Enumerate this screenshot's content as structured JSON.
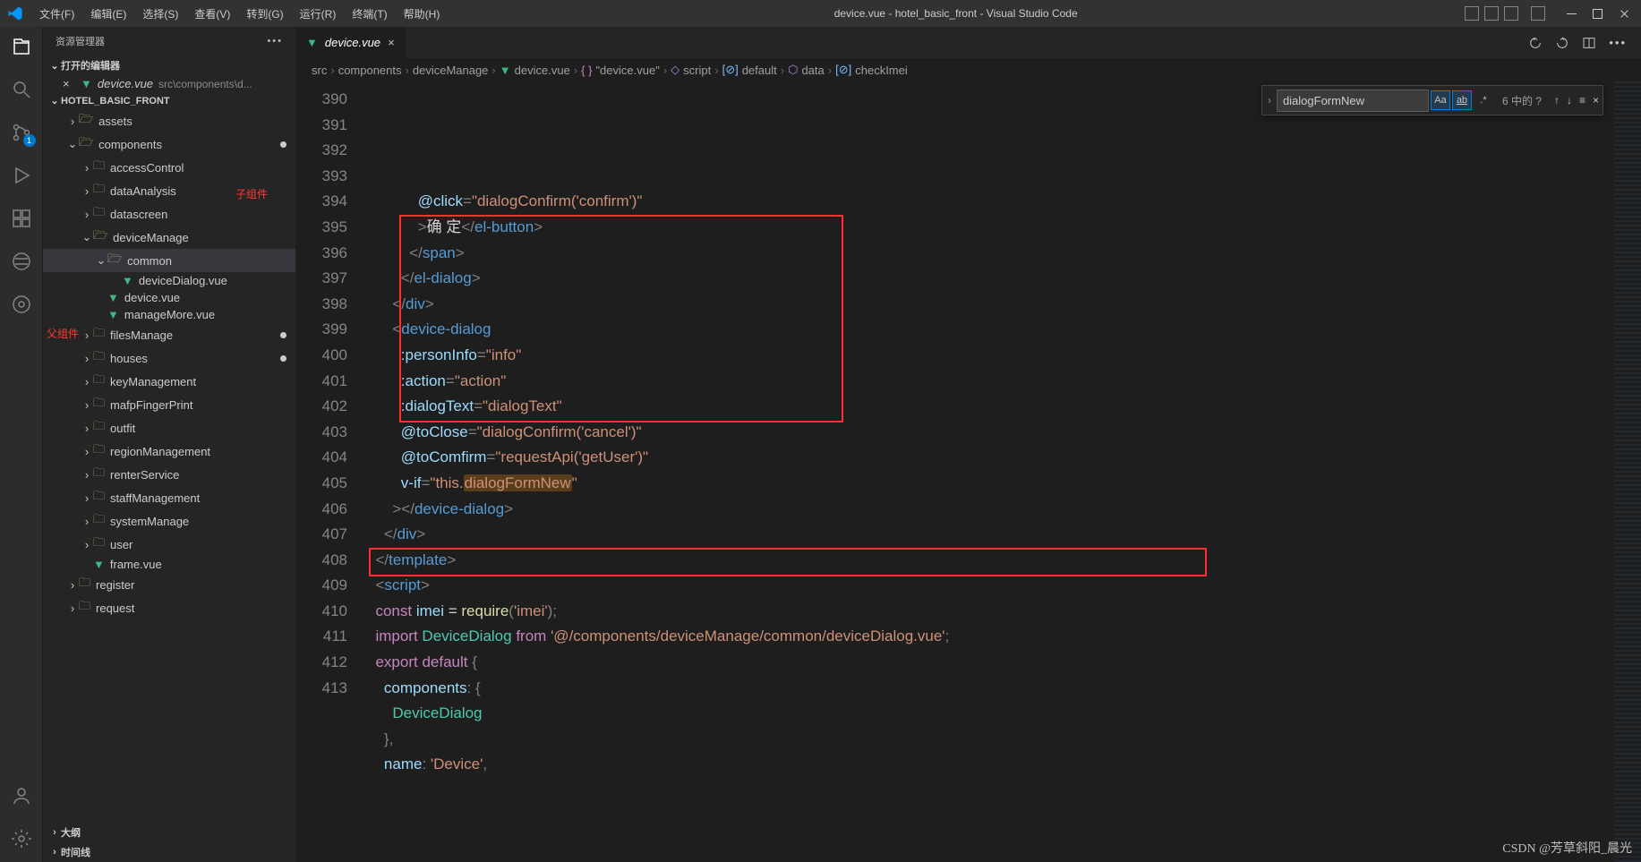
{
  "titlebar": {
    "menus": [
      "文件(F)",
      "编辑(E)",
      "选择(S)",
      "查看(V)",
      "转到(G)",
      "运行(R)",
      "终端(T)",
      "帮助(H)"
    ],
    "title": "device.vue - hotel_basic_front - Visual Studio Code"
  },
  "activity": {
    "scm_badge": "1"
  },
  "sidebar": {
    "title": "资源管理器",
    "sections": {
      "openEditors": "打开的编辑器",
      "project": "HOTEL_BASIC_FRONT",
      "outline": "大纲",
      "timeline": "时间线"
    },
    "openEditor": {
      "file": "device.vue",
      "path": "src\\components\\d..."
    },
    "tree": [
      {
        "depth": 0,
        "chev": "›",
        "type": "folder-open",
        "label": "assets"
      },
      {
        "depth": 0,
        "chev": "⌄",
        "type": "folder-open",
        "label": "components",
        "dot": true
      },
      {
        "depth": 1,
        "chev": "›",
        "type": "folder",
        "label": "accessControl"
      },
      {
        "depth": 1,
        "chev": "›",
        "type": "folder",
        "label": "dataAnalysis"
      },
      {
        "depth": 1,
        "chev": "›",
        "type": "folder",
        "label": "datascreen"
      },
      {
        "depth": 1,
        "chev": "⌄",
        "type": "folder-open",
        "label": "deviceManage"
      },
      {
        "depth": 2,
        "chev": "⌄",
        "type": "folder-open",
        "label": "common",
        "selected": true
      },
      {
        "depth": 3,
        "chev": "",
        "type": "vue",
        "label": "deviceDialog.vue"
      },
      {
        "depth": 2,
        "chev": "",
        "type": "vue",
        "label": "device.vue"
      },
      {
        "depth": 2,
        "chev": "",
        "type": "vue",
        "label": "manageMore.vue"
      },
      {
        "depth": 1,
        "chev": "›",
        "type": "folder",
        "label": "filesManage",
        "dot": true
      },
      {
        "depth": 1,
        "chev": "›",
        "type": "folder",
        "label": "houses",
        "dot": true
      },
      {
        "depth": 1,
        "chev": "›",
        "type": "folder",
        "label": "keyManagement"
      },
      {
        "depth": 1,
        "chev": "›",
        "type": "folder",
        "label": "mafpFingerPrint"
      },
      {
        "depth": 1,
        "chev": "›",
        "type": "folder",
        "label": "outfit"
      },
      {
        "depth": 1,
        "chev": "›",
        "type": "folder",
        "label": "regionManagement"
      },
      {
        "depth": 1,
        "chev": "›",
        "type": "folder",
        "label": "renterService"
      },
      {
        "depth": 1,
        "chev": "›",
        "type": "folder",
        "label": "staffManagement"
      },
      {
        "depth": 1,
        "chev": "›",
        "type": "folder",
        "label": "systemManage"
      },
      {
        "depth": 1,
        "chev": "›",
        "type": "folder",
        "label": "user"
      },
      {
        "depth": 1,
        "chev": "",
        "type": "vue",
        "label": "frame.vue"
      },
      {
        "depth": 0,
        "chev": "›",
        "type": "folder",
        "label": "register"
      },
      {
        "depth": 0,
        "chev": "›",
        "type": "folder",
        "label": "request"
      }
    ],
    "annotations": {
      "child": "子组件",
      "parent": "父组件"
    }
  },
  "tab": {
    "file": "device.vue"
  },
  "breadcrumbs": [
    "src",
    "components",
    "deviceManage",
    "device.vue",
    "\"device.vue\"",
    "script",
    "default",
    "data",
    "checkImei"
  ],
  "find": {
    "value": "dialogFormNew",
    "count": "6 中的 ?"
  },
  "code": {
    "startLine": 390,
    "lines": [
      [
        [
          "            ",
          "txt"
        ],
        [
          "@click",
          "attr"
        ],
        [
          "=",
          "punc"
        ],
        [
          "\"dialogConfirm('confirm')\"",
          "str"
        ]
      ],
      [
        [
          "            ",
          "txt"
        ],
        [
          ">",
          "punc"
        ],
        [
          "确 定",
          "txt"
        ],
        [
          "</",
          "punc"
        ],
        [
          "el-button",
          "tag"
        ],
        [
          ">",
          "punc"
        ]
      ],
      [
        [
          "          ",
          "txt"
        ],
        [
          "</",
          "punc"
        ],
        [
          "span",
          "tag"
        ],
        [
          ">",
          "punc"
        ]
      ],
      [
        [
          "        ",
          "txt"
        ],
        [
          "</",
          "punc"
        ],
        [
          "el-dialog",
          "tag"
        ],
        [
          ">",
          "punc"
        ]
      ],
      [
        [
          "      ",
          "txt"
        ],
        [
          "</",
          "punc"
        ],
        [
          "div",
          "tag"
        ],
        [
          ">",
          "punc"
        ]
      ],
      [
        [
          "      ",
          "txt"
        ],
        [
          "<",
          "punc"
        ],
        [
          "device-dialog",
          "tag"
        ]
      ],
      [
        [
          "        ",
          "txt"
        ],
        [
          ":personInfo",
          "attr"
        ],
        [
          "=",
          "punc"
        ],
        [
          "\"info\"",
          "str"
        ]
      ],
      [
        [
          "        ",
          "txt"
        ],
        [
          ":action",
          "attr"
        ],
        [
          "=",
          "punc"
        ],
        [
          "\"action\"",
          "str"
        ]
      ],
      [
        [
          "        ",
          "txt"
        ],
        [
          ":dialogText",
          "attr"
        ],
        [
          "=",
          "punc"
        ],
        [
          "\"dialogText\"",
          "str"
        ]
      ],
      [
        [
          "        ",
          "txt"
        ],
        [
          "@toClose",
          "attr"
        ],
        [
          "=",
          "punc"
        ],
        [
          "\"dialogConfirm('cancel')\"",
          "str"
        ]
      ],
      [
        [
          "        ",
          "txt"
        ],
        [
          "@toComfirm",
          "attr"
        ],
        [
          "=",
          "punc"
        ],
        [
          "\"requestApi('getUser')\"",
          "str"
        ]
      ],
      [
        [
          "        ",
          "txt"
        ],
        [
          "v-if",
          "attr"
        ],
        [
          "=",
          "punc"
        ],
        [
          "\"this.",
          "str"
        ],
        [
          "dialogFormNew",
          "hl"
        ],
        [
          "\"",
          "str"
        ]
      ],
      [
        [
          "      ",
          "txt"
        ],
        [
          "></",
          "punc"
        ],
        [
          "device-dialog",
          "tag"
        ],
        [
          ">",
          "punc"
        ]
      ],
      [
        [
          "    ",
          "txt"
        ],
        [
          "</",
          "punc"
        ],
        [
          "div",
          "tag"
        ],
        [
          ">",
          "punc"
        ]
      ],
      [
        [
          "  ",
          "txt"
        ],
        [
          "</",
          "punc"
        ],
        [
          "template",
          "tag"
        ],
        [
          ">",
          "punc"
        ]
      ],
      [
        [
          "",
          "txt"
        ]
      ],
      [
        [
          "  ",
          "txt"
        ],
        [
          "<",
          "punc"
        ],
        [
          "script",
          "tag"
        ],
        [
          ">",
          "punc"
        ]
      ],
      [
        [
          "  ",
          "txt"
        ],
        [
          "const",
          "kw"
        ],
        [
          " ",
          "txt"
        ],
        [
          "imei",
          "var"
        ],
        [
          " = ",
          "txt"
        ],
        [
          "require",
          "fn"
        ],
        [
          "(",
          "punc"
        ],
        [
          "'imei'",
          "str"
        ],
        [
          ");",
          "punc"
        ]
      ],
      [
        [
          "  ",
          "txt"
        ],
        [
          "import",
          "kw"
        ],
        [
          " ",
          "txt"
        ],
        [
          "DeviceDialog",
          "type"
        ],
        [
          " ",
          "txt"
        ],
        [
          "from",
          "kw"
        ],
        [
          " ",
          "txt"
        ],
        [
          "'@/components/deviceManage/common/deviceDialog.vue'",
          "str"
        ],
        [
          ";",
          "punc"
        ]
      ],
      [
        [
          "  ",
          "txt"
        ],
        [
          "export",
          "kw"
        ],
        [
          " ",
          "txt"
        ],
        [
          "default",
          "kw"
        ],
        [
          " {",
          "punc"
        ]
      ],
      [
        [
          "    ",
          "txt"
        ],
        [
          "components",
          "var"
        ],
        [
          ": {",
          "punc"
        ]
      ],
      [
        [
          "      ",
          "txt"
        ],
        [
          "DeviceDialog",
          "type"
        ]
      ],
      [
        [
          "    },",
          "punc"
        ]
      ],
      [
        [
          "    ",
          "txt"
        ],
        [
          "name",
          "var"
        ],
        [
          ": ",
          "punc"
        ],
        [
          "'Device'",
          "str"
        ],
        [
          ",",
          "punc"
        ]
      ]
    ]
  },
  "watermark": "CSDN @芳草斜阳_晨光"
}
